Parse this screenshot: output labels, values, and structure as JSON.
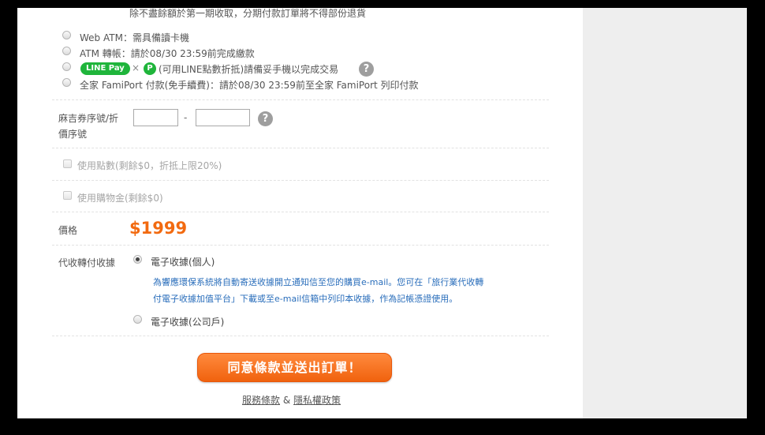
{
  "installment_note": "除不盡餘額於第一期收取，分期付款訂單將不得部份退貨",
  "payment_options": [
    {
      "label": "Web ATM：需具備讀卡機"
    },
    {
      "label": "ATM 轉帳：請於08/30 23:59前完成繳款"
    },
    {
      "label": "(可用LINE點數折抵)請備妥手機以完成交易"
    },
    {
      "label": "全家 FamiPort 付款(免手續費)：請於08/30 23:59前至全家 FamiPort 列印付款"
    }
  ],
  "linepay": {
    "badge": "LINE Pay",
    "times": "×",
    "p": "P"
  },
  "help": "?",
  "coupon": {
    "label_line1": "麻吉券序號/折",
    "label_line2": "價序號",
    "separator": "-",
    "code1": "",
    "code2": ""
  },
  "use_points": "使用點數(剩餘$0，折抵上限20%)",
  "use_credit": "使用購物金(剩餘$0)",
  "price": {
    "label": "價格",
    "value": "$1999"
  },
  "receipt": {
    "label": "代收轉付收據",
    "options": [
      {
        "label": "電子收據(個人)",
        "checked": true
      },
      {
        "label": "電子收據(公司戶)",
        "checked": false
      }
    ],
    "note_line1": "為響應環保系統將自動寄送收據開立通知信至您的購買e-mail。您可在「旅行業代收轉",
    "note_line2": "付電子收據加值平台」下載或至e-mail信箱中列印本收據，作為記帳憑證使用。"
  },
  "submit_label": "同意條款並送出訂單！",
  "footer": {
    "terms": "服務條款",
    "amp": "&",
    "privacy": "隱私權政策"
  },
  "colors": {
    "price": "#f26a10",
    "submit": "#f26a10",
    "linepay_green": "#1fb53b",
    "note_blue": "#2a6ebb"
  }
}
